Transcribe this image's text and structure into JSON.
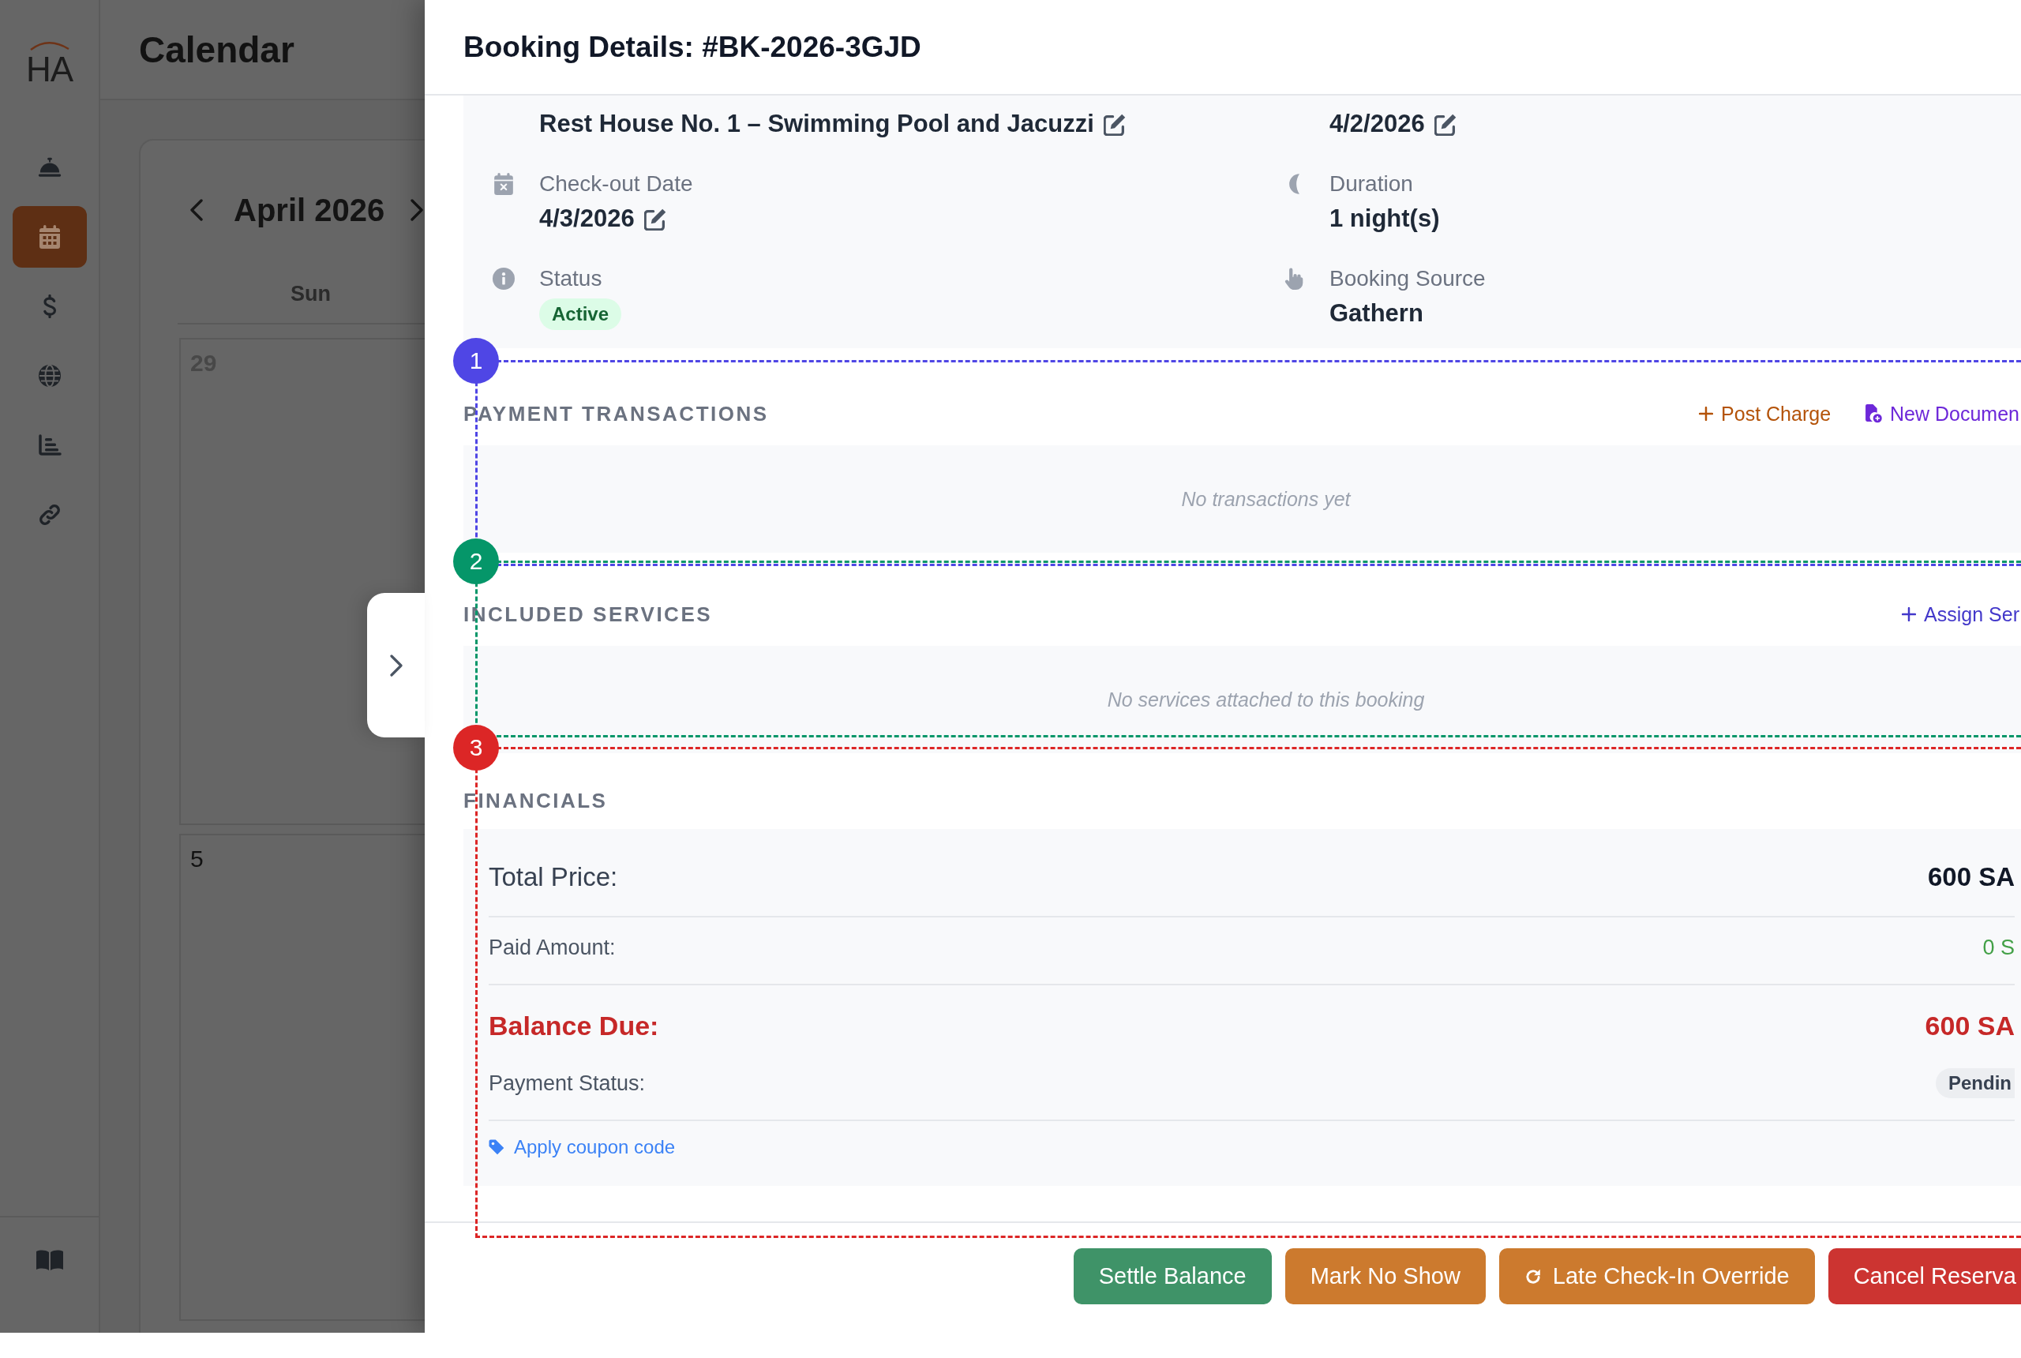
{
  "sidebar": {
    "logo": "HA",
    "items": [
      {
        "selected": false
      },
      {
        "selected": true
      },
      {
        "selected": false
      },
      {
        "selected": false
      },
      {
        "selected": false
      },
      {
        "selected": false
      }
    ]
  },
  "page_header": {
    "title": "Calendar"
  },
  "calendar": {
    "month": "April 2026",
    "weekdays": [
      "Sun"
    ],
    "days": [
      {
        "label": "29",
        "outside_month": true
      },
      {
        "label": "5",
        "outside_month": false
      }
    ]
  },
  "booking_panel": {
    "title": "Booking Details: #BK-2026-3GJD",
    "fields": [
      {
        "value": "Rest House No. 1 – Swimming Pool and Jacuzzi",
        "kind": "text",
        "editable": true
      },
      {
        "value": "4/2/2026",
        "kind": "text",
        "editable": true
      },
      {
        "label": "Check-out Date",
        "value": "4/3/2026",
        "kind": "text",
        "editable": true
      },
      {
        "label": "Duration",
        "value": "1 night(s)",
        "kind": "text",
        "editable": false
      },
      {
        "label": "Status",
        "value": "Active",
        "kind": "badge",
        "editable": false
      },
      {
        "label": "Booking Source",
        "value": "Gathern",
        "kind": "text",
        "editable": false
      }
    ],
    "sections": [
      {
        "kind": "list",
        "title": "PAYMENT TRANSACTIONS",
        "actions": [
          {
            "label": "Post Charge",
            "color": "#b45309"
          },
          {
            "label": "New Documen",
            "color": "#6d28d9"
          }
        ],
        "empty_text": "No transactions yet",
        "marker": {
          "number": "1",
          "color": "#4f46e5"
        }
      },
      {
        "kind": "list",
        "title": "INCLUDED SERVICES",
        "actions": [
          {
            "label": "Assign Ser",
            "color": "#4338ca"
          }
        ],
        "empty_text": "No services attached to this booking",
        "marker": {
          "number": "2",
          "color": "#059669"
        }
      },
      {
        "kind": "financials",
        "title": "FINANCIALS",
        "rows": [
          {
            "kind": "total",
            "label": "Total Price:",
            "value": "600 SA"
          },
          {
            "kind": "paid",
            "label": "Paid Amount:",
            "value": "0 S"
          },
          {
            "kind": "balance",
            "label": "Balance Due:",
            "value": "600 SA"
          },
          {
            "kind": "status",
            "label": "Payment Status:",
            "value": "Pendin"
          }
        ],
        "coupon_link": "Apply coupon code",
        "marker": {
          "number": "3",
          "color": "#dc2626"
        }
      }
    ],
    "buttons": [
      {
        "label": "Settle Balance",
        "color": "#3f9368"
      },
      {
        "label": "Mark No Show",
        "color": "#cc7a2e"
      },
      {
        "label": "Late Check-In Override",
        "color": "#cc7a2e"
      },
      {
        "label": "Cancel Reserva",
        "color": "#cc3431"
      }
    ]
  }
}
